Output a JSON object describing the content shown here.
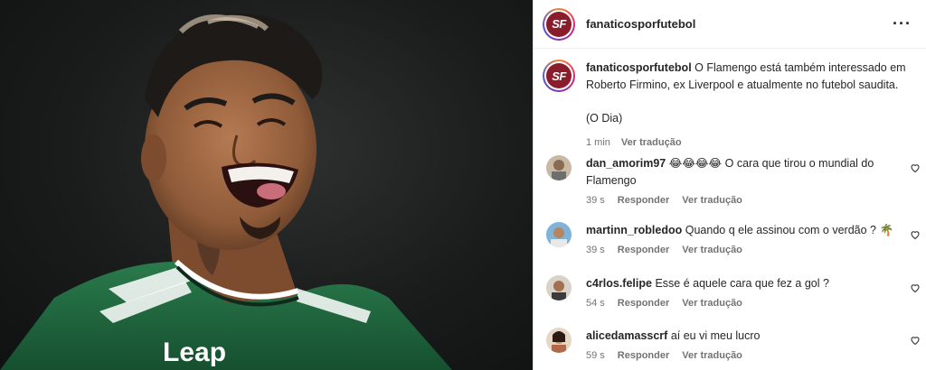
{
  "post": {
    "username": "fanaticosporfutebol",
    "avatar_text": "SF",
    "more_label": "···"
  },
  "caption": {
    "username": "fanaticosporfutebol",
    "text": "O Flamengo está também interessado em Roberto Firmino, ex Liverpool e atualmente no futebol saudita.",
    "source": "(O Dia)",
    "time": "1 min",
    "translate": "Ver tradução"
  },
  "comments": [
    {
      "username": "dan_amorim97",
      "emojis": "😂😂😂😂",
      "text": "O cara que tirou o mundial do Flamengo",
      "time": "39 s",
      "reply": "Responder",
      "translate": "Ver tradução"
    },
    {
      "username": "martinn_robledoo",
      "emojis": "",
      "text": "Quando q ele assinou com o verdão ? 🌴",
      "time": "39 s",
      "reply": "Responder",
      "translate": "Ver tradução"
    },
    {
      "username": "c4rlos.felipe",
      "emojis": "",
      "text": "Esse é aquele cara que fez a gol ?",
      "time": "54 s",
      "reply": "Responder",
      "translate": "Ver tradução"
    },
    {
      "username": "alicedamasscrf",
      "emojis": "",
      "text": "aí eu vi meu lucro",
      "time": "59 s",
      "reply": "Responder",
      "translate": "Ver tradução"
    }
  ],
  "photo": {
    "jersey_brand": "Leap",
    "jersey_color": "#1f6b3f",
    "background_color": "#1a1c1c"
  },
  "colors": {
    "brand": "#8a1c2b",
    "muted": "#737373",
    "text": "#262626"
  }
}
